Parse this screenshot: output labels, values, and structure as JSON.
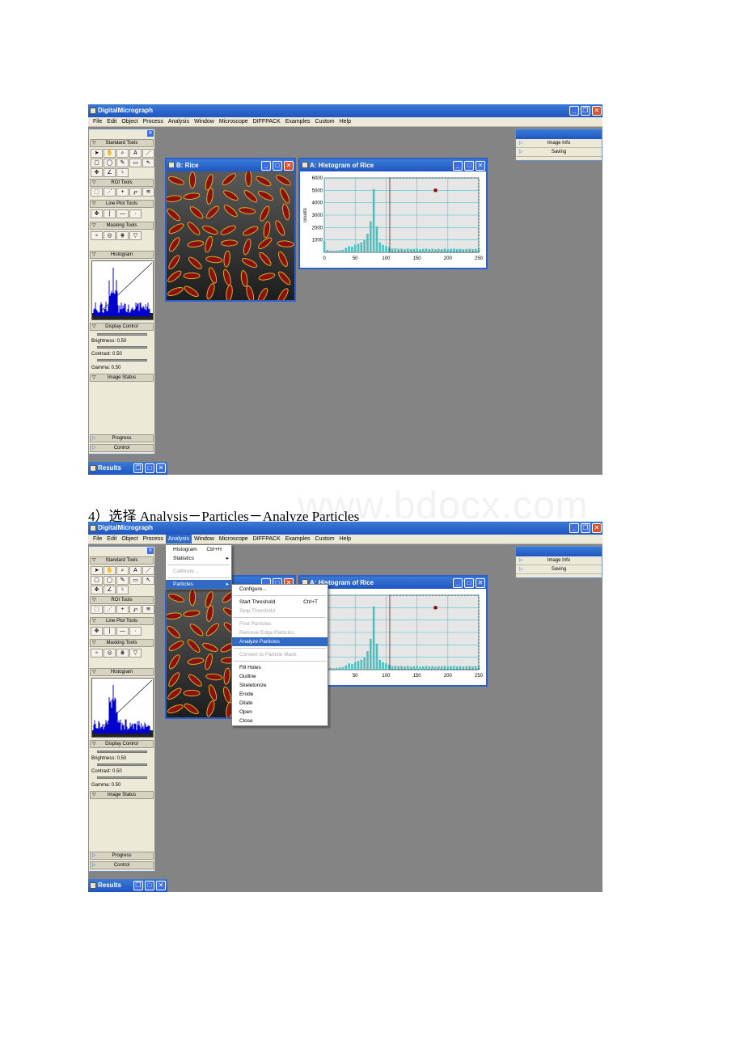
{
  "app": {
    "title": "DigitalMicrograph"
  },
  "menu": [
    "File",
    "Edit",
    "Object",
    "Process",
    "Analysis",
    "Window",
    "Microscope",
    "DIFFPACK",
    "Examples",
    "Custom",
    "Help"
  ],
  "tools": {
    "standard": "Standard Tools",
    "roi": "ROI Tools",
    "lineplot": "Line Plot Tools",
    "masking": "Masking Tools",
    "histogram": "Histogram",
    "display": "Display Control",
    "brightness": "Brightness: 0.50",
    "contrast": "Contrast: 0.50",
    "gamma": "Gamma: 0.50",
    "status": "Image Status",
    "progress": "Progress",
    "control": "Control"
  },
  "right_panel": {
    "items": [
      "Image Info",
      "Saving"
    ]
  },
  "windows": {
    "rice": "B: Rice",
    "histo": "A: Histogram of Rice",
    "results": "Results"
  },
  "caption": "4）选择 Analysis－Particles－Analyze Particles",
  "watermark": "www.bdocx.com",
  "analysis_menu": [
    {
      "label": "Histogram",
      "shortcut": "Ctrl+H",
      "state": "normal"
    },
    {
      "label": "Statistics",
      "arrow": true,
      "state": "normal"
    },
    {
      "label": "Calibrate...",
      "state": "disabled"
    },
    {
      "label": "Particles",
      "arrow": true,
      "state": "highlight"
    }
  ],
  "particles_menu": [
    {
      "label": "Configure...",
      "state": "normal"
    },
    {
      "label": "Start Threshold",
      "shortcut": "Ctrl+T",
      "state": "normal"
    },
    {
      "label": "Stop Threshold",
      "state": "disabled"
    },
    {
      "label": "Find Particles",
      "state": "disabled"
    },
    {
      "label": "Remove Edge Particles",
      "state": "disabled"
    },
    {
      "label": "Analyze Particles",
      "state": "highlight"
    },
    {
      "label": "Convert to Particle Mask",
      "state": "disabled"
    },
    {
      "label": "Fill Holes",
      "state": "normal"
    },
    {
      "label": "Outline",
      "state": "normal"
    },
    {
      "label": "Skeletonize",
      "state": "normal"
    },
    {
      "label": "Erode",
      "state": "normal"
    },
    {
      "label": "Dilate",
      "state": "normal"
    },
    {
      "label": "Open",
      "state": "normal"
    },
    {
      "label": "Close",
      "state": "normal"
    }
  ],
  "chart_data": {
    "type": "bar",
    "title": "",
    "xlabel": "",
    "ylabel": "counts",
    "xlim": [
      0,
      250
    ],
    "ylim": [
      0,
      6000
    ],
    "xticks": [
      0,
      50,
      100,
      150,
      200,
      250
    ],
    "yticks": [
      1000,
      2000,
      3000,
      4000,
      5000,
      6000
    ],
    "x": [
      0,
      5,
      10,
      15,
      20,
      25,
      30,
      35,
      40,
      45,
      50,
      55,
      60,
      65,
      70,
      75,
      80,
      85,
      90,
      95,
      100,
      105,
      110,
      115,
      120,
      125,
      130,
      135,
      140,
      145,
      150,
      155,
      160,
      165,
      170,
      175,
      180,
      185,
      190,
      195,
      200,
      205,
      210,
      215,
      220,
      225,
      230,
      235,
      240,
      245,
      250
    ],
    "values": [
      900,
      200,
      150,
      120,
      150,
      180,
      200,
      350,
      500,
      450,
      600,
      700,
      800,
      1000,
      1500,
      2500,
      5100,
      2100,
      800,
      600,
      500,
      400,
      300,
      320,
      280,
      300,
      260,
      300,
      250,
      280,
      300,
      250,
      270,
      300,
      260,
      290,
      250,
      280,
      260,
      300,
      250,
      280,
      300,
      260,
      280,
      250,
      270,
      290,
      260,
      280,
      300
    ]
  }
}
